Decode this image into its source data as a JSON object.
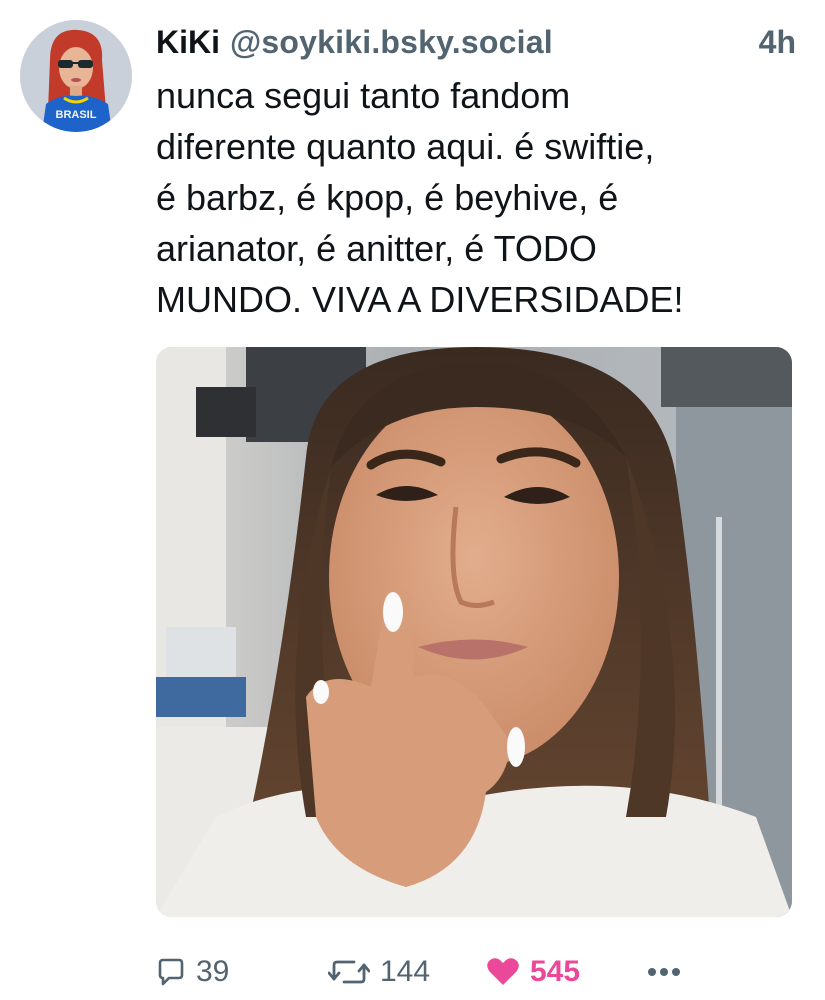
{
  "post": {
    "display_name": "KiKi",
    "handle": "@soykiki.bsky.social",
    "time": "4h",
    "text": "nunca segui tanto fandom\ndiferente quanto aqui. é swiftie,\né barbz, é kpop, é beyhive, é\narianator, é anitter, é TODO\nMUNDO. VIVA A DIVERSIDADE!",
    "avatar_shirt_text": "BRASIL"
  },
  "actions": {
    "replies": "39",
    "reposts": "144",
    "likes": "545"
  },
  "colors": {
    "like_accent": "#ec4899",
    "muted": "#536471"
  },
  "icons": {
    "reply": "speech-bubble-icon",
    "repost": "repost-arrows-icon",
    "like": "heart-icon",
    "more": "ellipsis-icon"
  }
}
